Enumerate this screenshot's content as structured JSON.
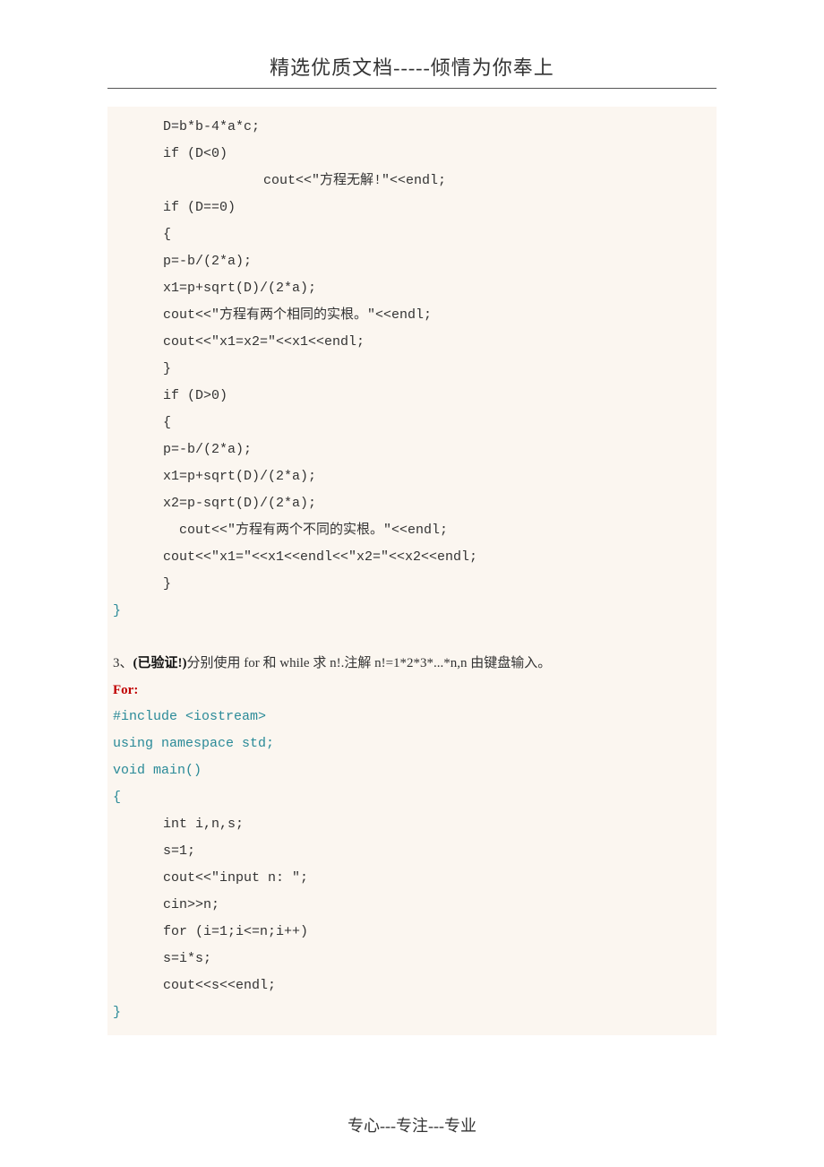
{
  "header": "精选优质文档-----倾情为你奉上",
  "footer": "专心---专注---专业",
  "code1": {
    "l1": "D=b*b-4*a*c;",
    "l2": "if (D<0)",
    "l3": "cout<<\"方程无解!\"<<endl;",
    "l4": "if (D==0)",
    "l5": "{",
    "l6": "p=-b/(2*a);",
    "l7": "x1=p+sqrt(D)/(2*a);",
    "l8": "cout<<\"方程有两个相同的实根。\"<<endl;",
    "l9": "cout<<\"x1=x2=\"<<x1<<endl;",
    "l10": "}",
    "l11": "if (D>0)",
    "l12": "{",
    "l13": "p=-b/(2*a);",
    "l14": "x1=p+sqrt(D)/(2*a);",
    "l15": "x2=p-sqrt(D)/(2*a);",
    "l16": "  cout<<\"方程有两个不同的实根。\"<<endl;",
    "l17": "cout<<\"x1=\"<<x1<<endl<<\"x2=\"<<x2<<endl;",
    "l18": "}",
    "l19": "}"
  },
  "question": {
    "prefix": "3、",
    "verified": "(已验证!)",
    "body": "分别使用 for 和 while 求 n!.注解 n!=1*2*3*...*n,n 由键盘输入。",
    "for_label": "For:"
  },
  "code2": {
    "l1": "#include <iostream>",
    "l2": "using namespace std;",
    "l3": "void main()",
    "l4": "{",
    "l5": "int i,n,s;",
    "l6": "s=1;",
    "l7": "cout<<\"input n: \";",
    "l8": "cin>>n;",
    "l9": "for (i=1;i<=n;i++)",
    "l10": "s=i*s;",
    "l11": "cout<<s<<endl;",
    "l12": "}"
  }
}
